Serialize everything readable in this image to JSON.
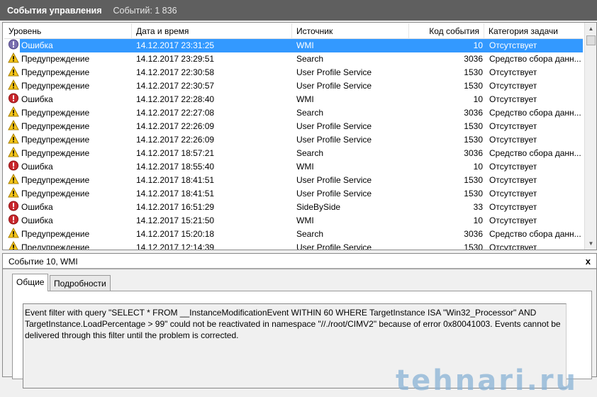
{
  "window": {
    "title": "События управления",
    "count": "Событий: 1 836"
  },
  "columns": [
    "Уровень",
    "Дата и время",
    "Источник",
    "Код события",
    "Категория задачи"
  ],
  "rows": [
    {
      "level": "Ошибка",
      "type": "error",
      "date": "14.12.2017 23:31:25",
      "source": "WMI",
      "code": "10",
      "category": "Отсутствует",
      "selected": true
    },
    {
      "level": "Предупреждение",
      "type": "warning",
      "date": "14.12.2017 23:29:51",
      "source": "Search",
      "code": "3036",
      "category": "Средство сбора данн..."
    },
    {
      "level": "Предупреждение",
      "type": "warning",
      "date": "14.12.2017 22:30:58",
      "source": "User Profile Service",
      "code": "1530",
      "category": "Отсутствует"
    },
    {
      "level": "Предупреждение",
      "type": "warning",
      "date": "14.12.2017 22:30:57",
      "source": "User Profile Service",
      "code": "1530",
      "category": "Отсутствует"
    },
    {
      "level": "Ошибка",
      "type": "error",
      "date": "14.12.2017 22:28:40",
      "source": "WMI",
      "code": "10",
      "category": "Отсутствует"
    },
    {
      "level": "Предупреждение",
      "type": "warning",
      "date": "14.12.2017 22:27:08",
      "source": "Search",
      "code": "3036",
      "category": "Средство сбора данн..."
    },
    {
      "level": "Предупреждение",
      "type": "warning",
      "date": "14.12.2017 22:26:09",
      "source": "User Profile Service",
      "code": "1530",
      "category": "Отсутствует"
    },
    {
      "level": "Предупреждение",
      "type": "warning",
      "date": "14.12.2017 22:26:09",
      "source": "User Profile Service",
      "code": "1530",
      "category": "Отсутствует"
    },
    {
      "level": "Предупреждение",
      "type": "warning",
      "date": "14.12.2017 18:57:21",
      "source": "Search",
      "code": "3036",
      "category": "Средство сбора данн..."
    },
    {
      "level": "Ошибка",
      "type": "error",
      "date": "14.12.2017 18:55:40",
      "source": "WMI",
      "code": "10",
      "category": "Отсутствует"
    },
    {
      "level": "Предупреждение",
      "type": "warning",
      "date": "14.12.2017 18:41:51",
      "source": "User Profile Service",
      "code": "1530",
      "category": "Отсутствует"
    },
    {
      "level": "Предупреждение",
      "type": "warning",
      "date": "14.12.2017 18:41:51",
      "source": "User Profile Service",
      "code": "1530",
      "category": "Отсутствует"
    },
    {
      "level": "Ошибка",
      "type": "error",
      "date": "14.12.2017 16:51:29",
      "source": "SideBySide",
      "code": "33",
      "category": "Отсутствует"
    },
    {
      "level": "Ошибка",
      "type": "error",
      "date": "14.12.2017 15:21:50",
      "source": "WMI",
      "code": "10",
      "category": "Отсутствует"
    },
    {
      "level": "Предупреждение",
      "type": "warning",
      "date": "14.12.2017 15:20:18",
      "source": "Search",
      "code": "3036",
      "category": "Средство сбора данн..."
    },
    {
      "level": "Предупреждение",
      "type": "warning",
      "date": "14.12.2017 12:14:39",
      "source": "User Profile Service",
      "code": "1530",
      "category": "Отсутствует"
    }
  ],
  "details": {
    "title": "Событие 10, WMI",
    "close": "x",
    "tabs": [
      "Общие",
      "Подробности"
    ],
    "description": "Event filter with query \"SELECT * FROM __InstanceModificationEvent WITHIN 60 WHERE TargetInstance ISA \"Win32_Processor\" AND TargetInstance.LoadPercentage > 99\" could not be reactivated in namespace \"//./root/CIMV2\" because of error 0x80041003. Events cannot be delivered through this filter until the problem is corrected.",
    "watermark": "tehnari.ru"
  },
  "colors": {
    "selection": "#3399ff",
    "titlebar": "#5f5f5f",
    "error": "#c8262c",
    "warning": "#f5c518"
  }
}
